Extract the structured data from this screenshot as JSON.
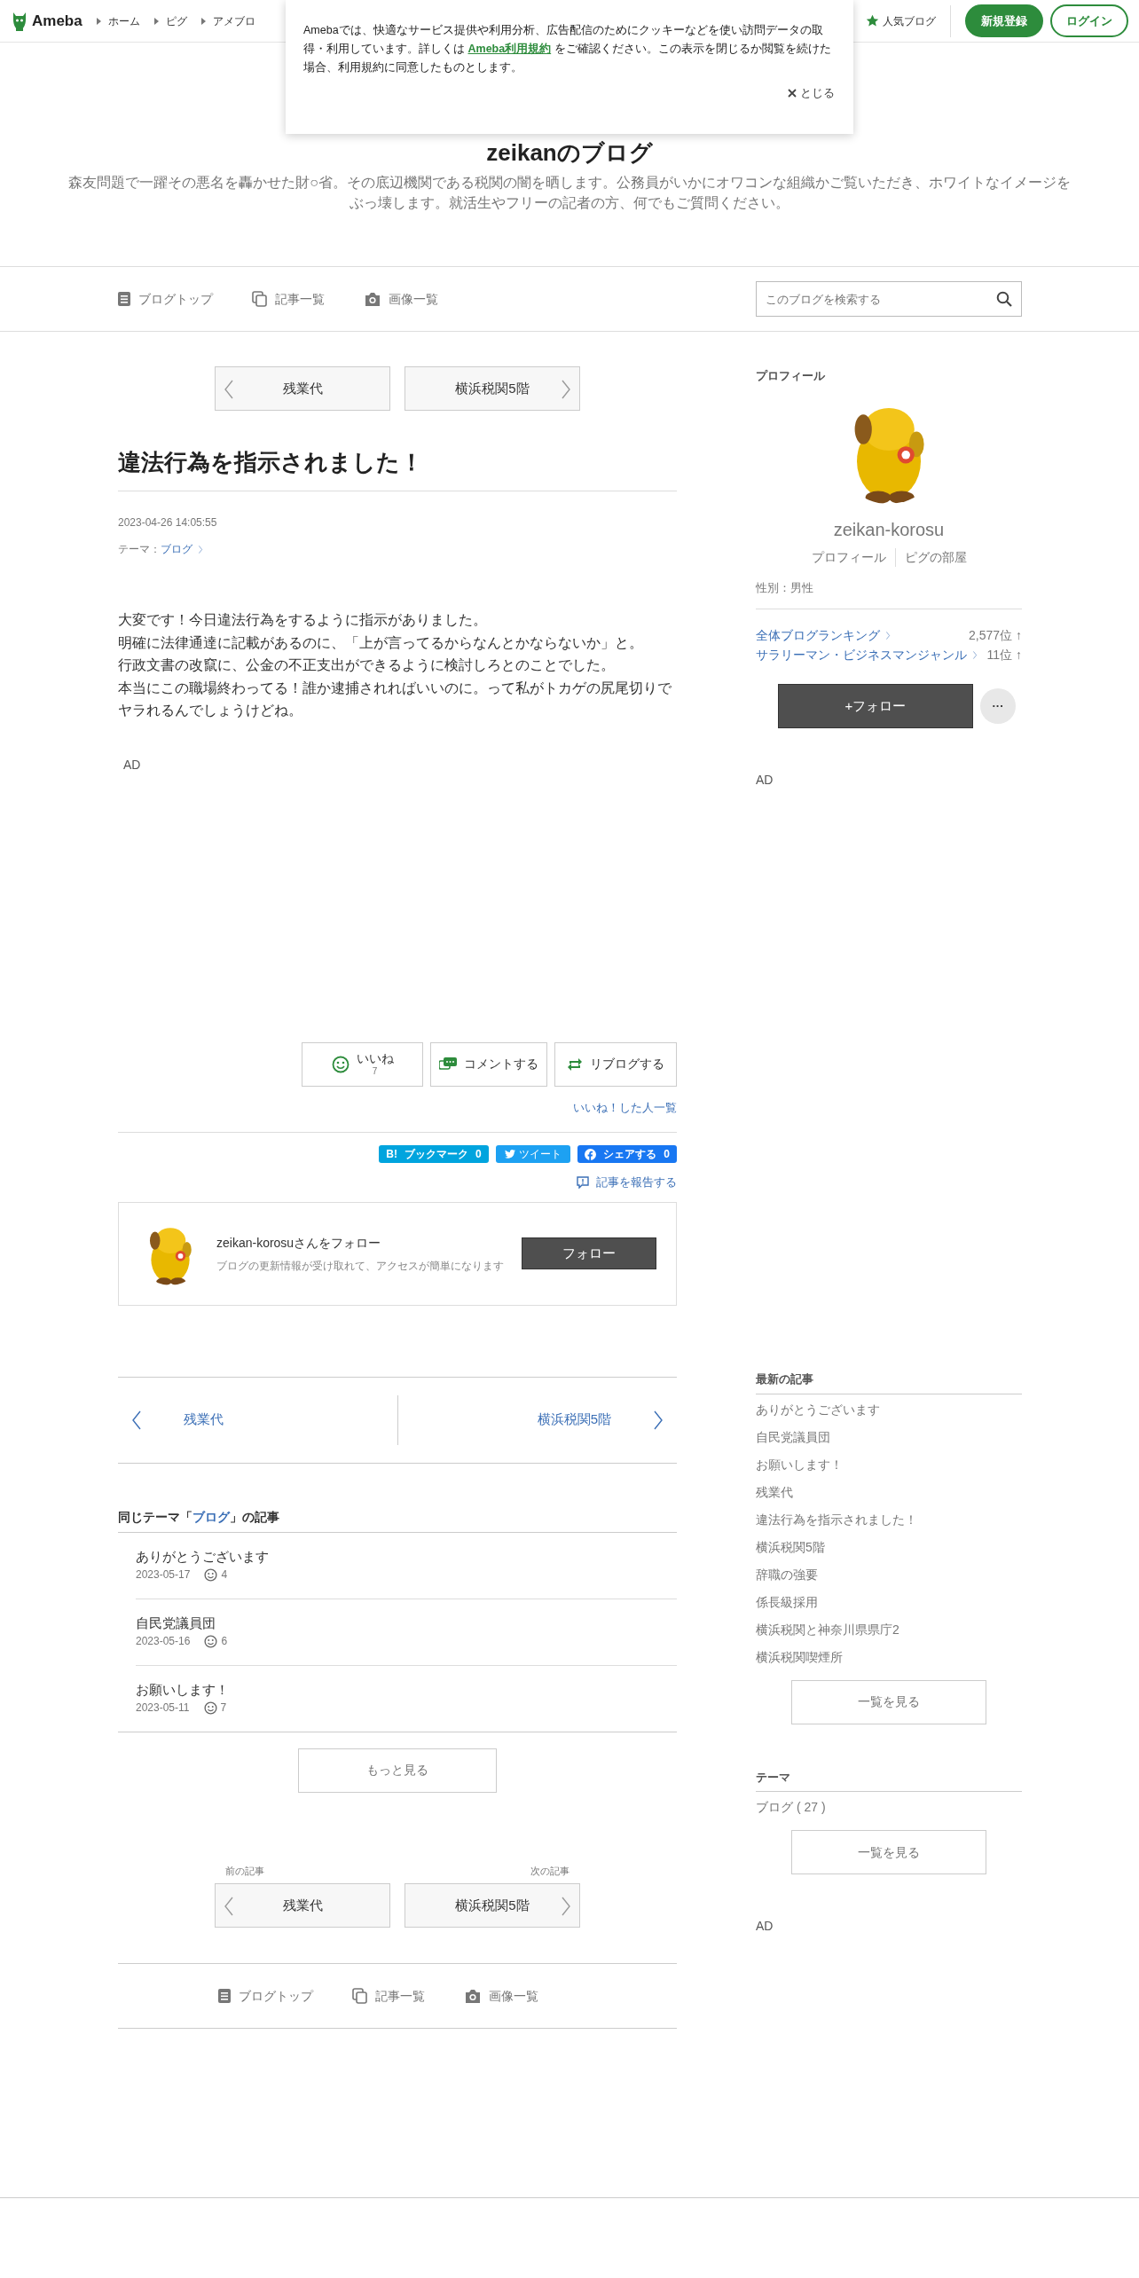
{
  "header": {
    "logo": "Ameba",
    "breadcrumbs": [
      "ホーム",
      "ピグ",
      "アメブロ"
    ],
    "popular": "人気ブログ",
    "signup": "新規登録",
    "login": "ログイン"
  },
  "cookie_notice": {
    "text_before": "Amebaでは、快適なサービス提供や利用分析、広告配信のためにクッキーなどを使い訪問データの取得・利用しています。詳しくは ",
    "link": "Ameba利用規約",
    "text_after": " をご確認ください。この表示を閉じるか閲覧を続けた場合、利用規約に同意したものとします。",
    "close": "とじる"
  },
  "blog": {
    "title": "zeikanのブログ",
    "description": "森友問題で一躍その悪名を轟かせた財○省。その底辺機関である税関の闇を晒します。公務員がいかにオワコンな組織かご覧いただき、ホワイトなイメージをぶっ壊します。就活生やフリーの記者の方、何でもご質問ください。"
  },
  "blog_nav": [
    {
      "kind": "top",
      "label": "ブログトップ"
    },
    {
      "kind": "entries",
      "label": "記事一覧"
    },
    {
      "kind": "images",
      "label": "画像一覧"
    }
  ],
  "search": {
    "placeholder": "このブログを検索する"
  },
  "pager_top": {
    "prev": "残業代",
    "next": "横浜税関5階"
  },
  "article": {
    "title": "違法行為を指示されました！",
    "date": "2023-04-26 14:05:55",
    "theme_label": "テーマ：",
    "theme": "ブログ",
    "body": [
      "大変です！今日違法行為をするように指示がありました。",
      "明確に法律通達に記載があるのに、「上が言ってるからなんとかならないか」と。",
      "行政文書の改竄に、公金の不正支出ができるように検討しろとのことでした。",
      "本当にこの職場終わってる！誰か逮捕されればいいのに。って私がトカゲの尻尾切りでヤラれるんでしょうけどね。"
    ],
    "ad": "AD"
  },
  "reactions": {
    "like": "いいね",
    "like_count": "7",
    "comment": "コメントする",
    "reblog": "リブログする",
    "liked_list": "いいね！した人一覧"
  },
  "share": {
    "bookmark_logo": "B!",
    "bookmark": "ブックマーク",
    "bookmark_count": "0",
    "tweet": "ツイート",
    "share": "シェアする",
    "share_count": "0",
    "report": "記事を報告する"
  },
  "follow_card": {
    "title": "zeikan-korosuさんをフォロー",
    "subtitle": "ブログの更新情報が受け取れて、アクセスが簡単になります",
    "button": "フォロー"
  },
  "article_nav": {
    "prev": "残業代",
    "next": "横浜税関5階"
  },
  "same_theme": {
    "prefix": "同じテーマ「",
    "theme": "ブログ",
    "suffix": "」の記事",
    "items": [
      {
        "title": "ありがとうございます",
        "date": "2023-05-17",
        "likes": "4"
      },
      {
        "title": "自民党議員団",
        "date": "2023-05-16",
        "likes": "6"
      },
      {
        "title": "お願いします！",
        "date": "2023-05-11",
        "likes": "7"
      }
    ],
    "more": "もっと見る"
  },
  "pager_bottom": {
    "prev_label": "前の記事",
    "prev": "残業代",
    "next_label": "次の記事",
    "next": "横浜税関5階"
  },
  "footer_nav": [
    {
      "kind": "top",
      "label": "ブログトップ"
    },
    {
      "kind": "entries",
      "label": "記事一覧"
    },
    {
      "kind": "images",
      "label": "画像一覧"
    }
  ],
  "sidebar": {
    "profile": {
      "heading": "プロフィール",
      "name": "zeikan-korosu",
      "links": [
        "プロフィール",
        "ピグの部屋"
      ],
      "gender": "性別：男性",
      "rankings": [
        {
          "label": "全体ブログランキング",
          "rank": "2,577位 ↑"
        },
        {
          "label": "サラリーマン・ビジネスマンジャンル",
          "rank": "11位 ↑"
        }
      ],
      "follow": "+フォロー",
      "more": "···"
    },
    "ad": "AD",
    "latest": {
      "heading": "最新の記事",
      "items": [
        "ありがとうございます",
        "自民党議員団",
        "お願いします！",
        "残業代",
        "違法行為を指示されました！",
        "横浜税関5階",
        "辞職の強要",
        "係長級採用",
        "横浜税関と神奈川県県庁2",
        "横浜税関喫煙所"
      ],
      "more": "一覧を見る"
    },
    "themes": {
      "heading": "テーマ",
      "items": [
        "ブログ ( 27 )"
      ],
      "more": "一覧を見る"
    },
    "ad2": "AD"
  }
}
